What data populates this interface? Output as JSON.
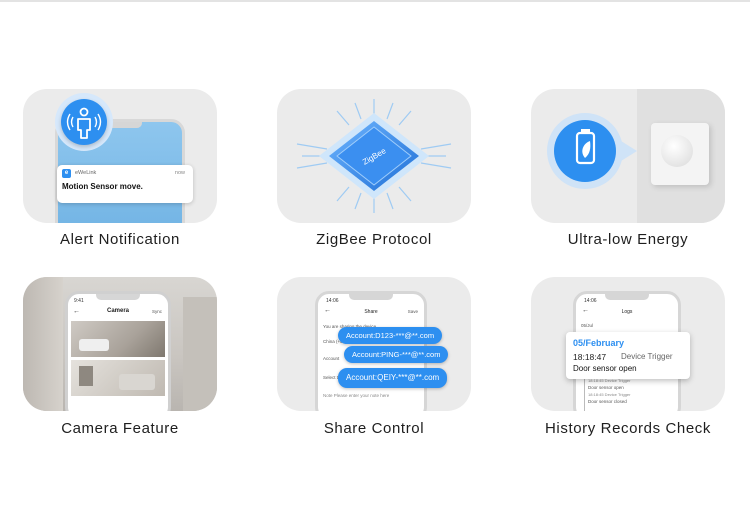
{
  "features": [
    {
      "label": "Alert Notification"
    },
    {
      "label": "ZigBee Protocol"
    },
    {
      "label": "Ultra-low Energy"
    },
    {
      "label": "Camera Feature"
    },
    {
      "label": "Share Control"
    },
    {
      "label": "History Records Check"
    }
  ],
  "alert": {
    "app_name": "eWeLink",
    "time": "now",
    "message": "Motion Sensor move."
  },
  "zigbee": {
    "chip_text": "ZigBee"
  },
  "camera": {
    "time": "9:41",
    "title": "Camera",
    "action": "Sync"
  },
  "share": {
    "time": "14:06",
    "title": "Share",
    "action": "Save",
    "accounts": [
      "Account:D123-***@**.com",
      "Account:PING-***@**.com",
      "Account:QEIY-***@**.com"
    ],
    "form_rows": [
      "You are sharing the device",
      "China (+86)",
      "Account",
      "Select timer",
      "Note  Please enter your note here"
    ]
  },
  "history": {
    "time": "14:06",
    "title": "Logs",
    "date_header": "05/Jul",
    "date": "05/February",
    "clock": "18:18:47",
    "trigger": "Device Trigger",
    "event": "Door sensor open",
    "log_rows": [
      "Door sensor closed",
      "18:18:45  Device Trigger",
      "Door sensor open",
      "18:18:45  Device Trigger",
      "Door sensor closed"
    ]
  },
  "colors": {
    "accent": "#2d8ff0",
    "tile_bg": "#ebebeb",
    "chip_blue": "#2a7fe8"
  }
}
